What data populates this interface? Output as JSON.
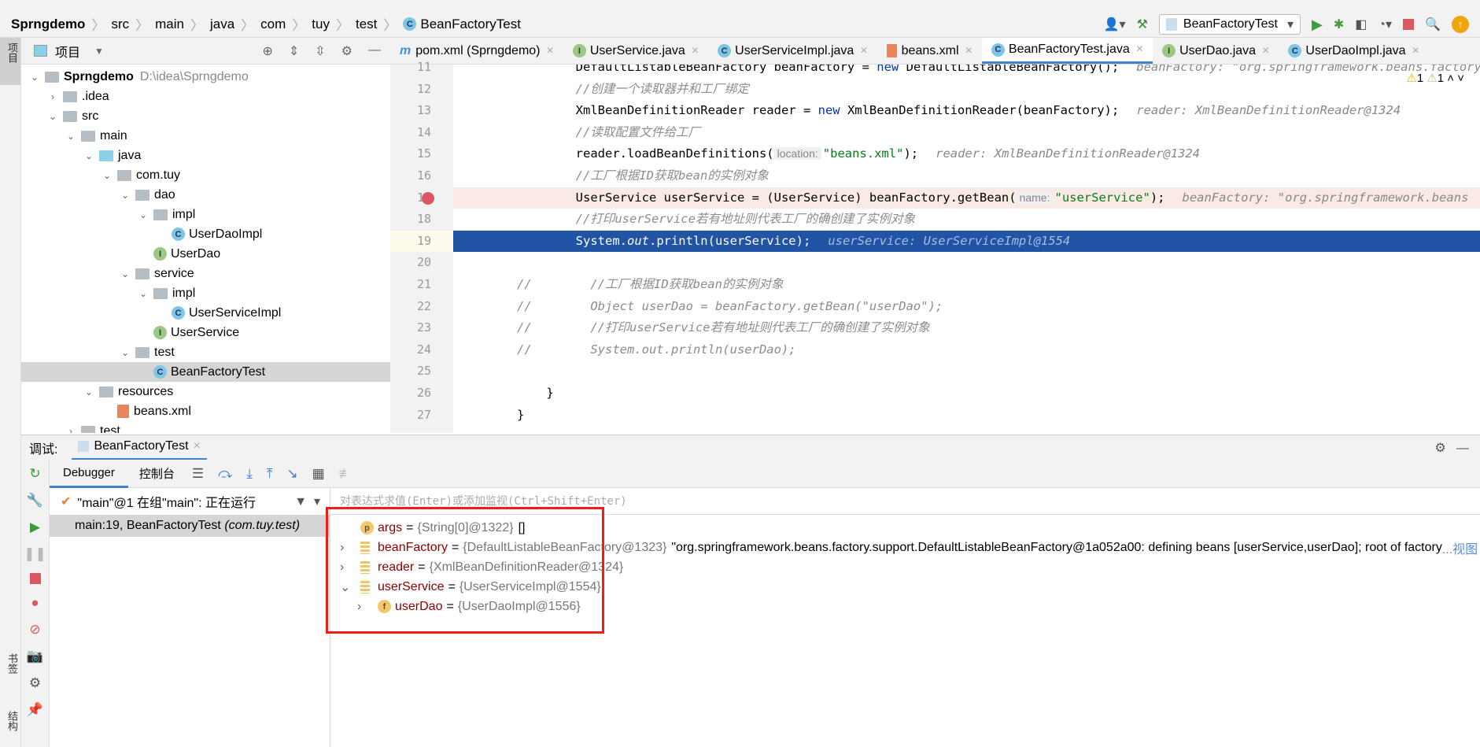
{
  "breadcrumb": [
    "Sprngdemo",
    "src",
    "main",
    "java",
    "com",
    "tuy",
    "test",
    "BeanFactoryTest"
  ],
  "toolbar": {
    "run_config": "BeanFactoryTest"
  },
  "project_panel": {
    "title": "项目",
    "root": "Sprngdemo",
    "root_path": "D:\\idea\\Sprngdemo",
    "items": [
      {
        "label": ".idea",
        "depth": 1,
        "type": "folder",
        "expanded": false
      },
      {
        "label": "src",
        "depth": 1,
        "type": "folder",
        "expanded": true
      },
      {
        "label": "main",
        "depth": 2,
        "type": "folder",
        "expanded": true
      },
      {
        "label": "java",
        "depth": 3,
        "type": "source-folder",
        "expanded": true
      },
      {
        "label": "com.tuy",
        "depth": 4,
        "type": "package",
        "expanded": true
      },
      {
        "label": "dao",
        "depth": 5,
        "type": "package",
        "expanded": true
      },
      {
        "label": "impl",
        "depth": 6,
        "type": "package",
        "expanded": true
      },
      {
        "label": "UserDaoImpl",
        "depth": 7,
        "type": "class"
      },
      {
        "label": "UserDao",
        "depth": 6,
        "type": "interface"
      },
      {
        "label": "service",
        "depth": 5,
        "type": "package",
        "expanded": true
      },
      {
        "label": "impl",
        "depth": 6,
        "type": "package",
        "expanded": true
      },
      {
        "label": "UserServiceImpl",
        "depth": 7,
        "type": "class"
      },
      {
        "label": "UserService",
        "depth": 6,
        "type": "interface"
      },
      {
        "label": "test",
        "depth": 5,
        "type": "package",
        "expanded": true
      },
      {
        "label": "BeanFactoryTest",
        "depth": 6,
        "type": "class",
        "selected": true
      },
      {
        "label": "resources",
        "depth": 3,
        "type": "folder",
        "expanded": true
      },
      {
        "label": "beans.xml",
        "depth": 4,
        "type": "xml"
      },
      {
        "label": "test",
        "depth": 2,
        "type": "folder",
        "expanded": false
      }
    ]
  },
  "editor_tabs": [
    {
      "label": "pom.xml (Sprngdemo)",
      "icon": "m"
    },
    {
      "label": "UserService.java",
      "icon": "I"
    },
    {
      "label": "UserServiceImpl.java",
      "icon": "C"
    },
    {
      "label": "beans.xml",
      "icon": "xml"
    },
    {
      "label": "BeanFactoryTest.java",
      "icon": "C",
      "active": true
    },
    {
      "label": "UserDao.java",
      "icon": "I"
    },
    {
      "label": "UserDaoImpl.java",
      "icon": "C"
    }
  ],
  "editor": {
    "warnings": "1",
    "weak_warnings": "1",
    "line_numbers": [
      "11",
      "12",
      "13",
      "14",
      "15",
      "16",
      "17",
      "18",
      "19",
      "20",
      "21",
      "22",
      "23",
      "24",
      "25",
      "26",
      "27"
    ],
    "lines": [
      {
        "html": "        DefaultListableBeanFactory beanFactory = <span class='kw'>new</span> DefaultListableBeanFactory();<span class='hint'>beanFactory: \"org.springframework.beans.factory</span>"
      },
      {
        "html": "        <span class='cm'>//创建一个读取器并和工厂绑定</span>"
      },
      {
        "html": "        XmlBeanDefinitionReader reader = <span class='kw'>new</span> XmlBeanDefinitionReader(beanFactory);<span class='hint'>reader: XmlBeanDefinitionReader@1324</span>"
      },
      {
        "html": "        <span class='cm'>//读取配置文件给工厂</span>"
      },
      {
        "html": "        reader.loadBeanDefinitions(<span class='ph'>location:</span><span class='str'>\"beans.xml\"</span>);<span class='hint'>reader: XmlBeanDefinitionReader@1324</span>"
      },
      {
        "html": "        <span class='cm'>//工厂根据ID获取bean的实例对象</span>"
      },
      {
        "html": "        UserService userService = (UserService) beanFactory.getBean(<span class='ph'>name:</span><span class='str'>\"userService\"</span>);<span class='hint'>beanFactory: \"org.springframework.beans</span>",
        "cls": "bp"
      },
      {
        "html": "        <span class='cm'>//打印userService若有地址则代表工厂的确创建了实例对象</span>"
      },
      {
        "html": "        System.<i>out</i>.println(userService);<span class='hint'>userService: UserServiceImpl@1554</span>",
        "cls": "cur"
      },
      {
        "html": ""
      },
      {
        "html": "<span class='cm'>//        //工厂根据ID获取bean的实例对象</span>"
      },
      {
        "html": "<span class='cm'>//        </span><span class='cm' style='font-style:italic'>Object userDao = beanFactory.getBean(\"userDao\");</span>"
      },
      {
        "html": "<span class='cm'>//        //打印userService若有地址则代表工厂的确创建了实例对象</span>"
      },
      {
        "html": "<span class='cm'>//        System.out.println(userDao);</span>"
      },
      {
        "html": ""
      },
      {
        "html": "    }"
      },
      {
        "html": "}"
      }
    ]
  },
  "debug": {
    "label": "调试:",
    "session_tab": "BeanFactoryTest",
    "tabs": [
      "Debugger",
      "控制台"
    ],
    "thread": "\"main\"@1 在组\"main\": 正在运行",
    "frame": "main:19, BeanFactoryTest",
    "frame_pkg": "(com.tuy.test)",
    "eval_placeholder": "对表达式求值(Enter)或添加监视(Ctrl+Shift+Enter)",
    "variables": [
      {
        "name": "args",
        "type": "{String[0]@1322}",
        "value": "[]",
        "icon": "p",
        "depth": 0,
        "expander": ""
      },
      {
        "name": "beanFactory",
        "type": "{DefaultListableBeanFactory@1323}",
        "value": "\"org.springframework.beans.factory.support.DefaultListableBeanFactory@1a052a00: defining beans [userService,userDao]; root of factory",
        "more": "...视图",
        "icon": "field-list",
        "depth": 0,
        "expander": "›"
      },
      {
        "name": "reader",
        "type": "{XmlBeanDefinitionReader@1324}",
        "value": "",
        "icon": "field-list",
        "depth": 0,
        "expander": "›"
      },
      {
        "name": "userService",
        "type": "{UserServiceImpl@1554}",
        "value": "",
        "icon": "field-list",
        "depth": 0,
        "expander": "⌄"
      },
      {
        "name": "userDao",
        "type": "{UserDaoImpl@1556}",
        "value": "",
        "icon": "f",
        "depth": 1,
        "expander": "›"
      }
    ],
    "side_labels": {
      "bookmarks": "书签",
      "structure": "结构",
      "project": "项目"
    }
  },
  "colors": {
    "accent": "#4083c9",
    "current_line": "#2154a5",
    "breakpoint_line": "#faeae6",
    "highlight_box": "#f21c1c"
  }
}
